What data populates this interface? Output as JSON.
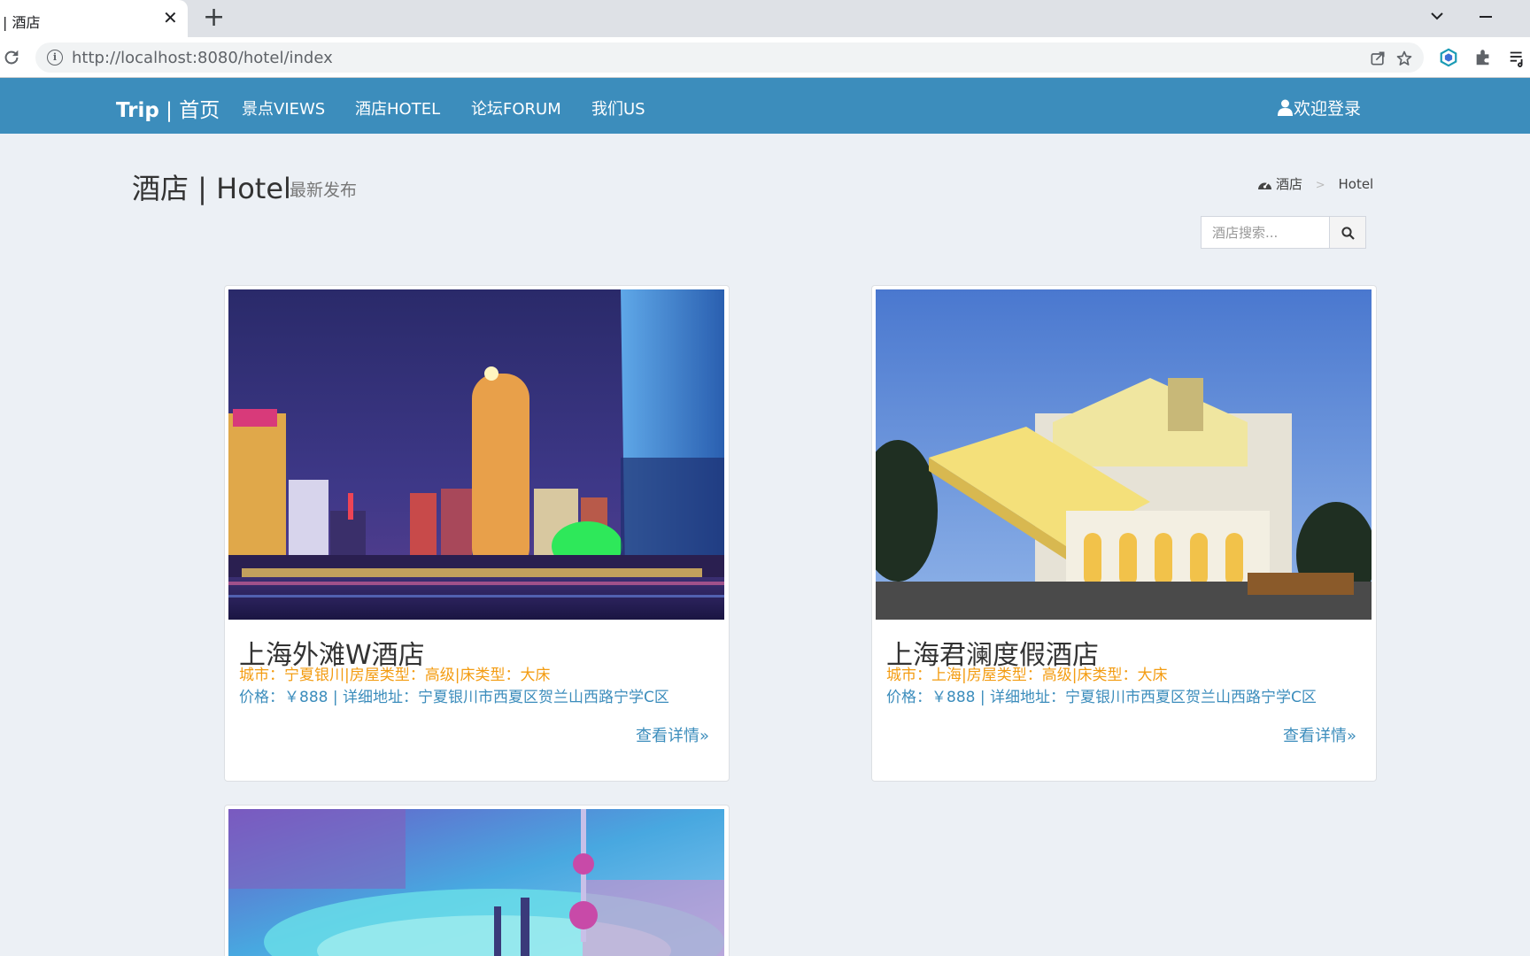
{
  "browser": {
    "tab_title": "| 酒店",
    "tab_close": "✕",
    "new_tab": "+",
    "url_host": "http://localhost",
    "url_path": ":8080/hotel/index"
  },
  "navbar": {
    "brand_bold": "Trip",
    "brand_rest": " | 首页",
    "items": [
      {
        "label": "景点VIEWS"
      },
      {
        "label": "酒店HOTEL"
      },
      {
        "label": "论坛FORUM"
      },
      {
        "label": "我们US"
      }
    ],
    "login_label": "欢迎登录"
  },
  "header": {
    "title": "酒店 | Hotel",
    "subtitle": "最新发布",
    "breadcrumb": {
      "home": "酒店",
      "separator": ">",
      "current": "Hotel"
    }
  },
  "search": {
    "placeholder": "酒店搜索..."
  },
  "hotels": [
    {
      "name": "上海外滩W酒店",
      "info_line1": "城市：宁夏银川|房屋类型：高级|床类型：大床",
      "info_line2": "价格：￥888 | 详细地址：宁夏银川市西夏区贺兰山西路宁学C区",
      "more_label": "查看详情»"
    },
    {
      "name": "上海君澜度假酒店",
      "info_line1": "城市：上海|房屋类型：高级|床类型：大床",
      "info_line2": "价格：￥888 | 详细地址：宁夏银川市西夏区贺兰山西路宁学C区",
      "more_label": "查看详情»"
    },
    {
      "name": "",
      "info_line1": "",
      "info_line2": "",
      "more_label": ""
    }
  ],
  "colors": {
    "navbar": "#3c8dbc",
    "page_background": "#ecf0f5",
    "info_orange": "#f39c12",
    "link_blue": "#3c8dbc"
  }
}
